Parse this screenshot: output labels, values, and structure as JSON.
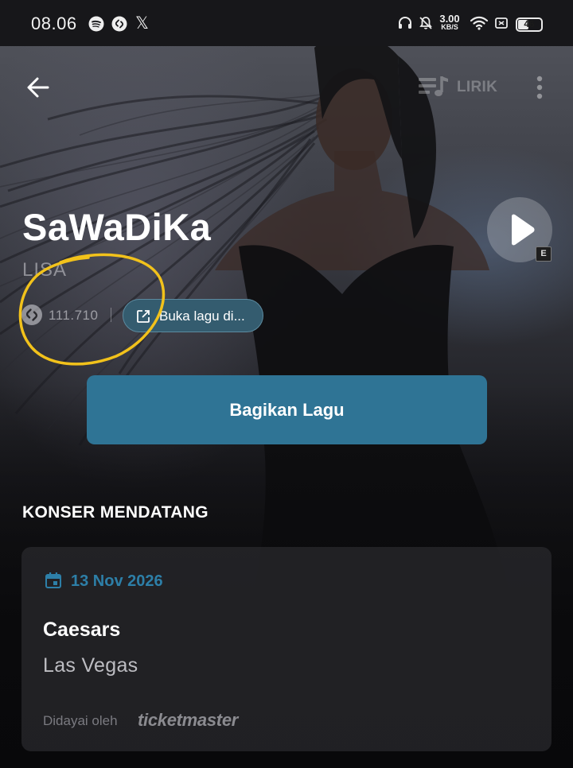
{
  "status_bar": {
    "time": "08.06",
    "network_speed_value": "3.00",
    "network_speed_unit": "KB/S",
    "battery_level": "46",
    "battery_fraction": 0.46,
    "icons": [
      "spotify-icon",
      "shazam-icon",
      "x-icon",
      "headphones-icon",
      "mute-icon",
      "wifi-icon",
      "sim-icon",
      "battery-icon"
    ]
  },
  "top_bar": {
    "lyrics_label": "LIRIK"
  },
  "song": {
    "title": "SaWaDiKa",
    "artist": "LISA",
    "shazam_count": "111.710",
    "open_song_label": "Buka lagu di...",
    "explicit_badge": "E"
  },
  "share_button_label": "Bagikan Lagu",
  "concerts": {
    "heading": "KONSER MENDATANG",
    "items": [
      {
        "date": "13 Nov 2026",
        "venue": "Caesars",
        "city": "Las Vegas",
        "powered_by": "Didayai oleh",
        "partner_logo": "ticketmaster"
      }
    ]
  },
  "colors": {
    "accent_blue": "#2f7495",
    "date_blue": "#2d7fa8",
    "chip_bg": "#345c6f",
    "annotation_yellow": "#f2c21b"
  }
}
